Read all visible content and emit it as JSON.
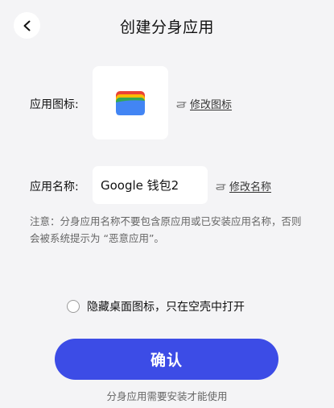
{
  "header": {
    "title": "创建分身应用",
    "back_icon": "chevron-left-icon"
  },
  "app_icon": {
    "label": "应用图标:",
    "icon": "google-wallet-icon",
    "edit_link": "修改图标",
    "edit_icon": "hand-point-icon"
  },
  "app_name": {
    "label": "应用名称:",
    "value": "Google 钱包2",
    "edit_link": "修改名称",
    "edit_icon": "hand-point-icon"
  },
  "notice": "注意：分身应用名称不要包含原应用或已安装应用名称，否则会被系统提示为 “恶意应用”。",
  "hide_option": {
    "label": "隐藏桌面图标，只在空壳中打开",
    "checked": false
  },
  "confirm_button": "确认",
  "footer_note": "分身应用需要安装才能使用",
  "colors": {
    "background": "#f4f4f6",
    "primary": "#3c4ce6",
    "card": "#ffffff",
    "muted_text": "#666666"
  }
}
